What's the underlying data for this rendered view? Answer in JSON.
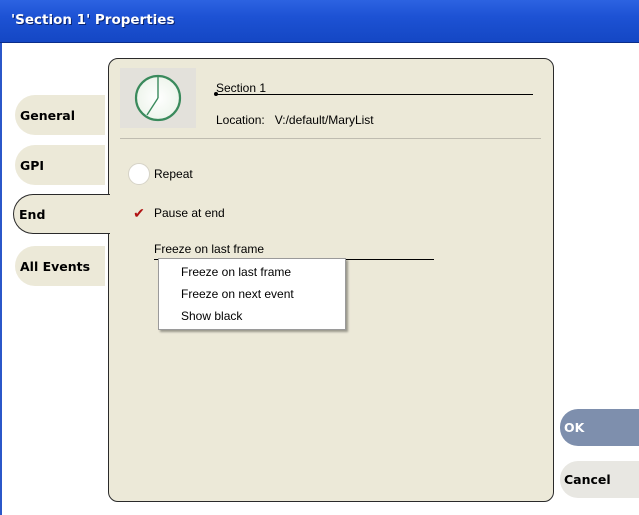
{
  "window": {
    "title": "'Section 1' Properties"
  },
  "tabs": [
    {
      "label": "General",
      "active": false
    },
    {
      "label": "GPI",
      "active": false
    },
    {
      "label": "End",
      "active": true
    },
    {
      "label": "All Events",
      "active": false
    }
  ],
  "section": {
    "name": "Section 1",
    "location_label": "Location:",
    "location_value": "V:/default/MaryList"
  },
  "options": {
    "repeat_label": "Repeat",
    "repeat_checked": false,
    "pause_label": "Pause at end",
    "pause_checked": true
  },
  "freeze": {
    "selected": "Freeze on last frame",
    "options": [
      "Freeze on last frame",
      "Freeze on next event",
      "Show black"
    ]
  },
  "buttons": {
    "ok": "OK",
    "cancel": "Cancel"
  },
  "icons": {
    "section": "clock-pie-icon",
    "check": "checkmark-icon"
  },
  "colors": {
    "titlebar": "#1d52d4",
    "panel": "#ece9d8",
    "ok_button": "#7e8fad",
    "check": "#b01212"
  }
}
